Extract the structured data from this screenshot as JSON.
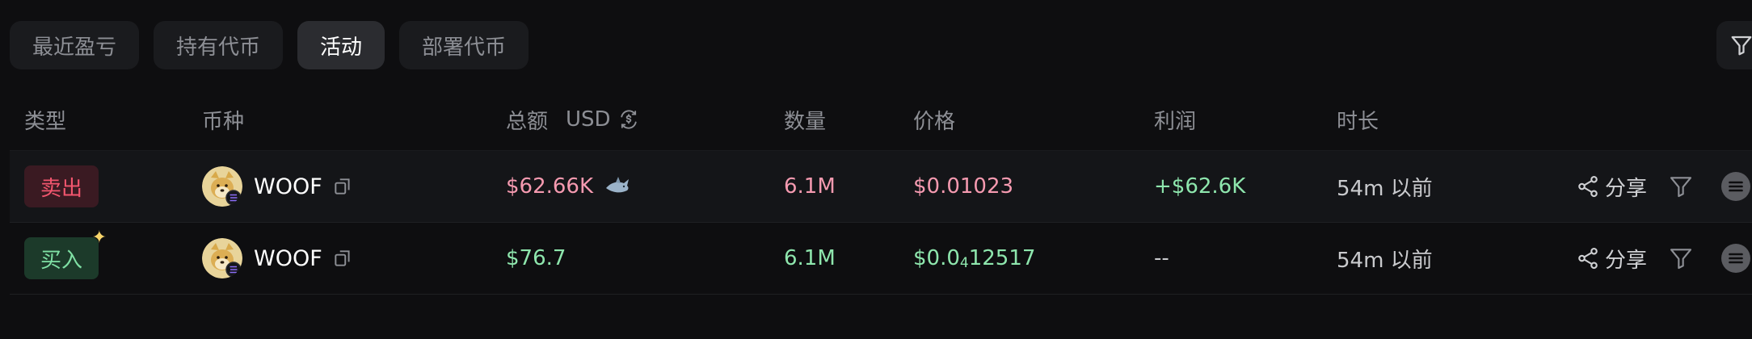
{
  "tabs": [
    {
      "label": "最近盈亏",
      "active": false
    },
    {
      "label": "持有代币",
      "active": false
    },
    {
      "label": "活动",
      "active": true
    },
    {
      "label": "部署代币",
      "active": false
    }
  ],
  "table": {
    "headers": {
      "type": "类型",
      "token": "币种",
      "total": "总额",
      "currency": "USD",
      "amount": "数量",
      "price": "价格",
      "profit": "利润",
      "duration": "时长"
    },
    "rows": [
      {
        "type": "卖出",
        "type_kind": "sell",
        "token": "WOOF",
        "total": "$62.66K",
        "total_icon": "shark-icon",
        "amount": "6.1M",
        "price_main": "$0.01023",
        "price_sub": "",
        "price_tail": "",
        "profit": "+$62.6K",
        "duration": "54m 以前",
        "share_label": "分享"
      },
      {
        "type": "买入",
        "type_kind": "buy",
        "token": "WOOF",
        "total": "$76.7",
        "total_icon": "",
        "amount": "6.1M",
        "price_main": "$0.0",
        "price_sub": "4",
        "price_tail": "12517",
        "profit": "--",
        "duration": "54m 以前",
        "share_label": "分享"
      }
    ]
  },
  "colors": {
    "background": "#0e0e10",
    "sell": "#f2566e",
    "buy": "#7fe0a4",
    "pink_value": "#f59ab0",
    "green_value": "#8ee6ad"
  }
}
